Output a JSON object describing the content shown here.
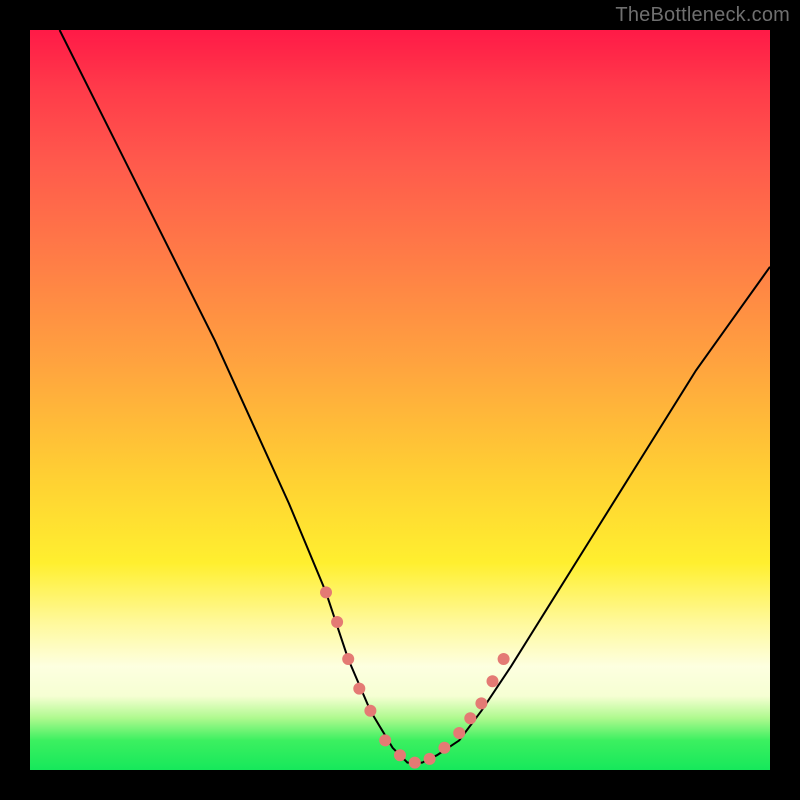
{
  "watermark": "TheBottleneck.com",
  "chart_data": {
    "type": "line",
    "title": "",
    "xlabel": "",
    "ylabel": "",
    "xlim": [
      0,
      100
    ],
    "ylim": [
      0,
      100
    ],
    "grid": false,
    "legend": false,
    "series": [
      {
        "name": "bottleneck-curve",
        "x": [
          4,
          10,
          15,
          20,
          25,
          30,
          35,
          40,
          43,
          46,
          49,
          51,
          53,
          55,
          58,
          61,
          65,
          70,
          75,
          80,
          85,
          90,
          95,
          100
        ],
        "y": [
          100,
          88,
          78,
          68,
          58,
          47,
          36,
          24,
          15,
          8,
          3,
          1,
          1,
          2,
          4,
          8,
          14,
          22,
          30,
          38,
          46,
          54,
          61,
          68
        ]
      }
    ],
    "markers": {
      "name": "highlight-dots",
      "x": [
        40,
        41.5,
        43,
        44.5,
        46,
        48,
        50,
        52,
        54,
        56,
        58,
        59.5,
        61,
        62.5,
        64
      ],
      "y": [
        24,
        20,
        15,
        11,
        8,
        4,
        2,
        1,
        1.5,
        3,
        5,
        7,
        9,
        12,
        15
      ]
    },
    "background_gradient": {
      "stops": [
        {
          "pos": 0.0,
          "color": "#ff1a47"
        },
        {
          "pos": 0.3,
          "color": "#ff7a47"
        },
        {
          "pos": 0.6,
          "color": "#ffcf33"
        },
        {
          "pos": 0.86,
          "color": "#fdffe0"
        },
        {
          "pos": 1.0,
          "color": "#16e85b"
        }
      ]
    }
  }
}
